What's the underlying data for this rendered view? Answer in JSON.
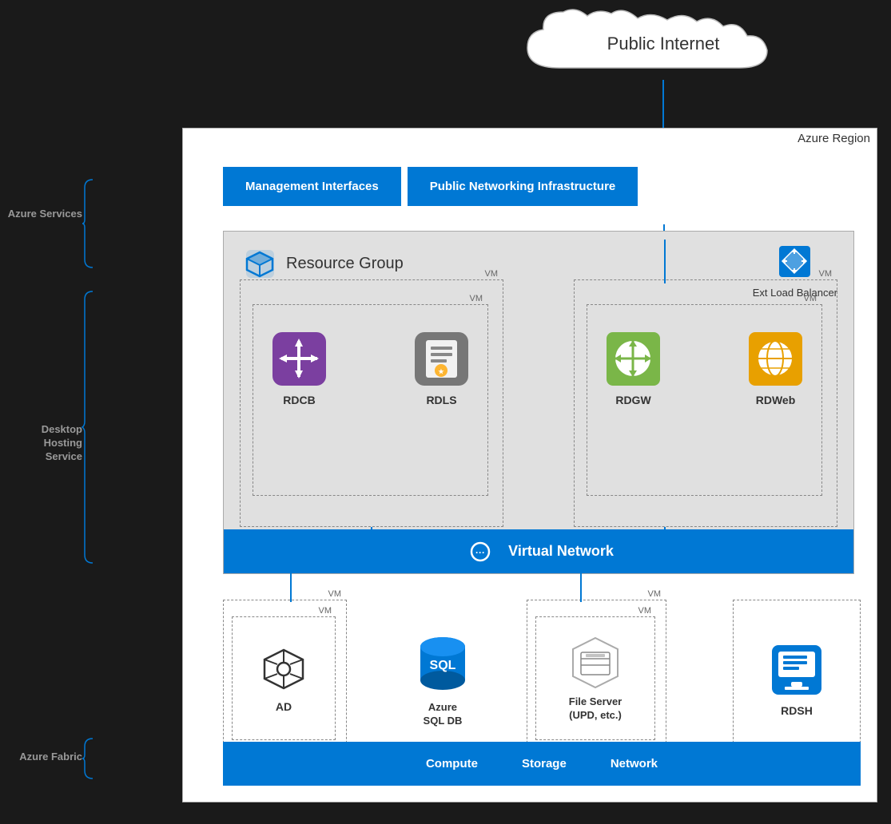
{
  "cloud": {
    "label": "Public Internet"
  },
  "azure_region_label": "Azure Region",
  "header_buttons": {
    "management": "Management Interfaces",
    "networking": "Public Networking Infrastructure"
  },
  "resource_group": {
    "title": "Resource Group",
    "ext_lb": "Ext Load Balancer"
  },
  "vm_labels": {
    "vm": "VM"
  },
  "services": {
    "rdcb": "RDCB",
    "rdls": "RDLS",
    "rdgw": "RDGW",
    "rdweb": "RDWeb",
    "ad": "AD",
    "azure_sql_db": "Azure\nSQL DB",
    "file_server": "File Server\n(UPD, etc.)",
    "rdsh": "RDSH"
  },
  "vnet": {
    "label": "Virtual Network"
  },
  "fabric": {
    "compute": "Compute",
    "storage": "Storage",
    "network": "Network"
  },
  "left_labels": {
    "azure_services": "Azure Services",
    "desktop_hosting": "Desktop Hosting Service",
    "azure_fabric": "Azure Fabric"
  }
}
